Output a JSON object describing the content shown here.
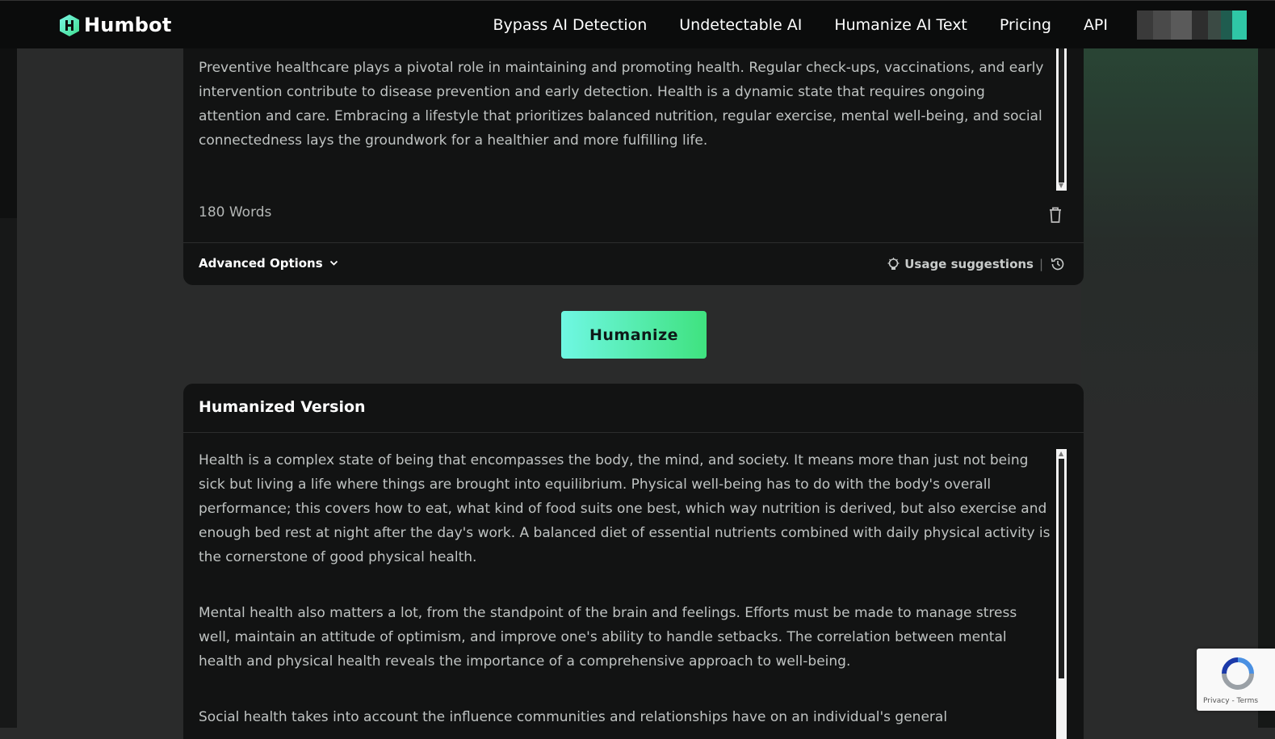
{
  "brand": {
    "name": "Humbot",
    "accent": "#5ff0c8"
  },
  "nav": {
    "links": [
      "Bypass AI Detection",
      "Undetectable AI",
      "Humanize AI Text",
      "Pricing",
      "API"
    ]
  },
  "input_card": {
    "text": "Preventive healthcare plays a pivotal role in maintaining and promoting health. Regular check-ups, vaccinations, and early intervention contribute to disease prevention and early detection. Health is a dynamic state that requires ongoing attention and care. Embracing a lifestyle that prioritizes balanced nutrition, regular exercise, mental well-being, and social connectedness lays the groundwork for a healthier and more fulfilling life.",
    "word_count": "180 Words",
    "advanced_options_label": "Advanced Options",
    "usage_suggestions_label": "Usage suggestions",
    "separator": "|"
  },
  "humanize_button": {
    "label": "Humanize"
  },
  "output_card": {
    "title": "Humanized Version",
    "paragraphs": [
      "Health is a complex state of being that encompasses the body, the mind, and society. It means more than just not being sick but living a life where things are brought into equilibrium. Physical well-being has to do with the body's overall performance; this covers how to eat, what kind of food suits one best, which way nutrition is derived, but also exercise and enough bed rest at night after the day's work. A balanced diet of essential nutrients combined with daily physical activity is the cornerstone of good physical health.",
      "Mental health also matters a lot, from the standpoint of the brain and feelings. Efforts must be made to manage stress well, maintain an attitude of optimism, and improve one's ability to handle setbacks. The correlation between mental health and physical health reveals the importance of a comprehensive approach to well-being.",
      "Social health takes into account the influence communities and relationships have on an individual's general"
    ]
  },
  "recaptcha": {
    "links": "Privacy - Terms"
  }
}
